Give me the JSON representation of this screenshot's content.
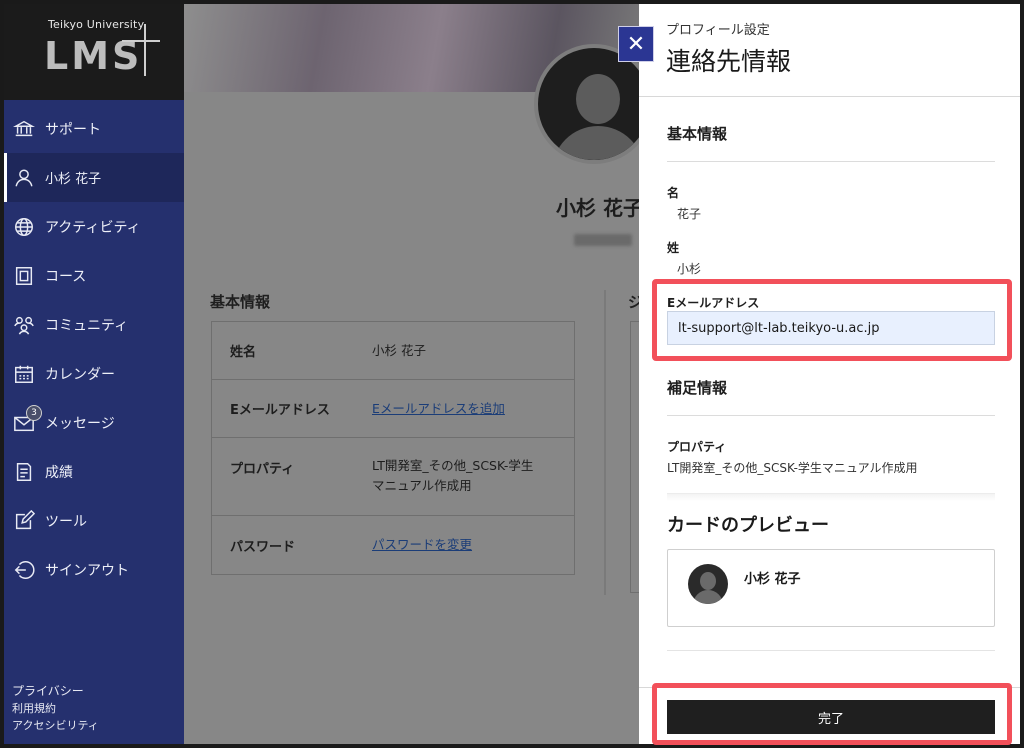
{
  "sidebar": {
    "logo_univ": "Teikyo University",
    "logo_lms": "LMS",
    "items": [
      {
        "label": "サポート",
        "icon": "institution-icon"
      },
      {
        "label": "小杉 花子",
        "icon": "user-icon"
      },
      {
        "label": "アクティビティ",
        "icon": "globe-icon"
      },
      {
        "label": "コース",
        "icon": "book-icon"
      },
      {
        "label": "コミュニティ",
        "icon": "community-icon"
      },
      {
        "label": "カレンダー",
        "icon": "calendar-icon"
      },
      {
        "label": "メッセージ",
        "icon": "mail-icon",
        "badge": "3"
      },
      {
        "label": "成績",
        "icon": "grades-icon"
      },
      {
        "label": "ツール",
        "icon": "edit-icon"
      },
      {
        "label": "サインアウト",
        "icon": "signout-icon"
      }
    ],
    "footer": [
      "プライバシー",
      "利用規約",
      "アクセシビリティ"
    ]
  },
  "profile": {
    "name": "小杉 花子",
    "section_title": "基本情報",
    "right_section_fragment": "ジ",
    "rows": [
      {
        "label": "姓名",
        "value": "小杉 花子"
      },
      {
        "label": "Eメールアドレス",
        "value": "Eメールアドレスを追加"
      },
      {
        "label": "プロパティ",
        "value": "LT開発室_その他_SCSK-学生マニュアル作成用"
      },
      {
        "label": "パスワード",
        "value": "パスワードを変更"
      }
    ]
  },
  "panel": {
    "subtitle": "プロフィール設定",
    "title": "連絡先情報",
    "basic_heading": "基本情報",
    "first_name_label": "名",
    "first_name_value": "花子",
    "last_name_label": "姓",
    "last_name_value": "小杉",
    "email_label": "Eメールアドレス",
    "email_value": "lt-support@lt-lab.teikyo-u.ac.jp",
    "extra_heading": "補足情報",
    "property_label": "プロパティ",
    "property_value": "LT開発室_その他_SCSK-学生マニュアル作成用",
    "preview_heading": "カードのプレビュー",
    "preview_name": "小杉 花子",
    "done_label": "完了",
    "close_label": "✕"
  },
  "colors": {
    "sidebar": "#25306e",
    "accent": "#2b3693",
    "highlight": "#f2505a",
    "done_button": "#1f1f1f"
  }
}
